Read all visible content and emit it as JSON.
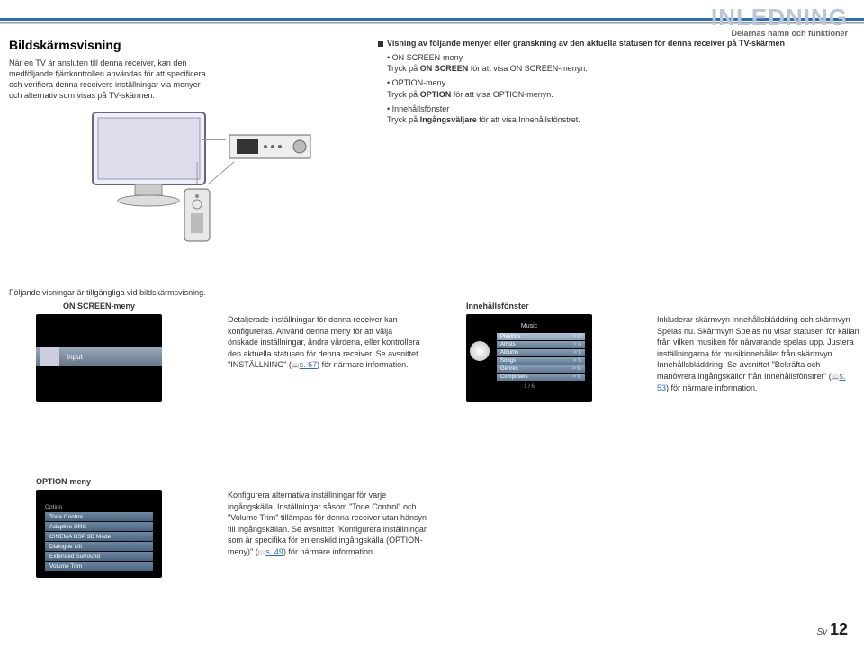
{
  "header": {
    "title": "INLEDNING",
    "subtitle": "Delarnas namn och funktioner"
  },
  "col1": {
    "heading": "Bildskärmsvisning",
    "body": "När en TV är ansluten till denna receiver, kan den medföljande fjärrkontrollen användas för att specificera och verifiera denna receivers inställningar via menyer och alternativ som visas på TV-skärmen."
  },
  "col2": {
    "intro": "Visning av följande menyer eller granskning av den aktuella statusen för denna receiver på TV-skärmen",
    "items": [
      {
        "label": "ON SCREEN-meny",
        "desc_pre": "Tryck på ",
        "desc_b": "ON SCREEN",
        "desc_post": " för att visa ON SCREEN-menyn."
      },
      {
        "label": "OPTION-meny",
        "desc_pre": "Tryck på ",
        "desc_b": "OPTION",
        "desc_post": " för att visa OPTION-menyn."
      },
      {
        "label": "Innehållsfönster",
        "desc_pre": "Tryck på ",
        "desc_b": "Ingångsväljare",
        "desc_post": " för att visa Innehållsfönstret."
      }
    ]
  },
  "mid_text": "Följande visningar är tillgängliga vid bildskärmsvisning.",
  "onscreen": {
    "label": "ON SCREEN-meny",
    "thumb_label": "Input",
    "desc": "Detaljerade inställningar för denna receiver kan konfigureras. Använd denna meny för att välja önskade inställningar, ändra värdena, eller kontrollera den aktuella statusen för denna receiver. Se avsnittet \"INSTÄLLNING\" (",
    "ref": "s. 67",
    "desc_end": ") för närmare information."
  },
  "content": {
    "label": "Innehållsfönster",
    "thumb": {
      "header": "Music",
      "rows": [
        {
          "l": "Playlists",
          "r": "> P"
        },
        {
          "l": "Artists",
          "r": "> A"
        },
        {
          "l": "Albums",
          "r": "> L"
        },
        {
          "l": "Songs",
          "r": "> S"
        },
        {
          "l": "Genres",
          "r": "> G"
        },
        {
          "l": "Composers",
          "r": "> C"
        }
      ],
      "footer": "1 / 6"
    },
    "desc_a": "Inkluderar skärmvyn Innehållsbläddring och skärmvyn Spelas nu. Skärmvyn Spelas nu visar statusen för källan från vilken musiken för närvarande spelas upp. Justera inställningarna för musikinnehållet från skärmvyn Innehållsbläddring. Se avsnittet \"Bekräfta och manövrera ingångskällor från Innehållsfönstret\" (",
    "ref": "s. 53",
    "desc_b": ") för närmare information."
  },
  "option": {
    "label": "OPTION-meny",
    "thumb_rows": [
      "Option",
      "Tone Control",
      "Adaptive DRC",
      "CINEMA DSP 3D Mode",
      "Dialogue Lift",
      "Extended Surround",
      "Volume Trim"
    ],
    "desc_a": "Konfigurera alternativa inställningar för varje ingångskälla. Inställningar såsom \"Tone Control\" och \"Volume Trim\" tillämpas för denna receiver utan hänsyn till ingångskällan. Se avsnittet \"Konfigurera inställningar som är specifika för en enskild ingångskälla (OPTION-meny)\" (",
    "ref": "s. 49",
    "desc_b": ") för närmare information."
  },
  "footer": {
    "lang": "Sv",
    "page": "12"
  }
}
